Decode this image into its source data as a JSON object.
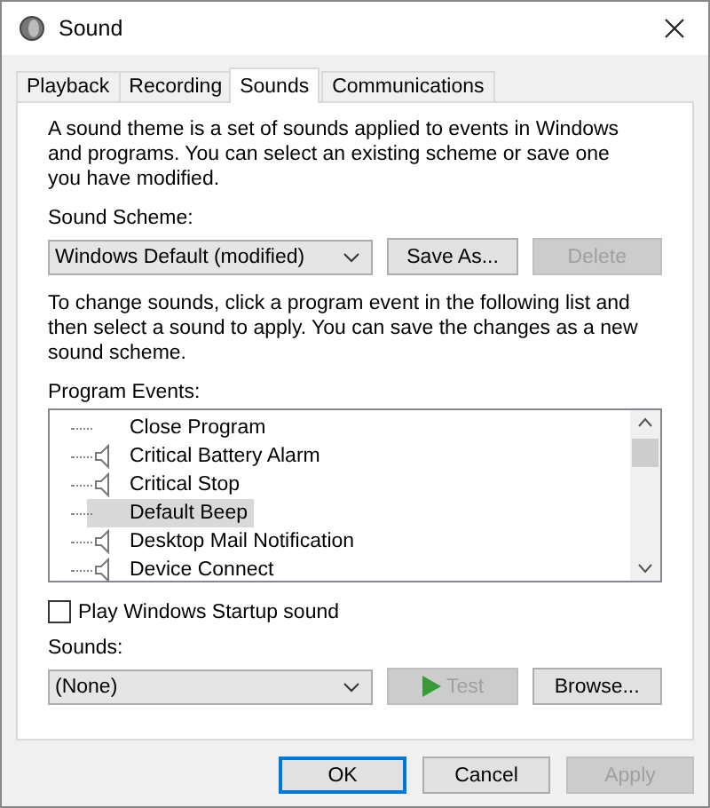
{
  "window": {
    "title": "Sound"
  },
  "tabs": [
    {
      "label": "Playback",
      "selected": false
    },
    {
      "label": "Recording",
      "selected": false
    },
    {
      "label": "Sounds",
      "selected": true
    },
    {
      "label": "Communications",
      "selected": false
    }
  ],
  "intro": "A sound theme is a set of sounds applied to events in Windows and programs.  You can select an existing scheme or save one you have modified.",
  "scheme": {
    "label": "Sound Scheme:",
    "value": "Windows Default (modified)",
    "buttons": [
      {
        "label": "Save As...",
        "disabled": false
      },
      {
        "label": "Delete",
        "disabled": true
      }
    ]
  },
  "instructions": "To change sounds, click a program event in the following list and then select a sound to apply.  You can save the changes as a new sound scheme.",
  "events": {
    "label": "Program Events:",
    "items": [
      {
        "name": "Close Program",
        "has_sound": false,
        "selected": false
      },
      {
        "name": "Critical Battery Alarm",
        "has_sound": true,
        "selected": false
      },
      {
        "name": "Critical Stop",
        "has_sound": true,
        "selected": false
      },
      {
        "name": "Default Beep",
        "has_sound": false,
        "selected": true
      },
      {
        "name": "Desktop Mail Notification",
        "has_sound": true,
        "selected": false
      },
      {
        "name": "Device Connect",
        "has_sound": true,
        "selected": false
      }
    ]
  },
  "startup": {
    "label": "Play Windows Startup sound",
    "checked": false
  },
  "sounds": {
    "label": "Sounds:",
    "value": "(None)",
    "test": {
      "label": "Test",
      "disabled": true
    },
    "browse": {
      "label": "Browse...",
      "disabled": false
    }
  },
  "footer": [
    {
      "label": "OK",
      "disabled": false,
      "default": true
    },
    {
      "label": "Cancel",
      "disabled": false,
      "default": false
    },
    {
      "label": "Apply",
      "disabled": true,
      "default": false
    }
  ]
}
